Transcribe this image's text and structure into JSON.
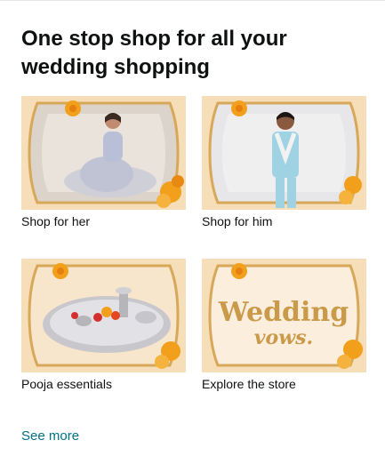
{
  "card": {
    "title": "One stop shop for all your wedding shopping",
    "see_more": "See more"
  },
  "tiles": [
    {
      "label": "Shop for her",
      "image": "woman-in-lehenga-photo"
    },
    {
      "label": "Shop for him",
      "image": "man-in-sherwani-photo"
    },
    {
      "label": "Pooja essentials",
      "image": "silver-pooja-thali-photo"
    },
    {
      "label": "Explore the store",
      "image": "wedding-vows-graphic",
      "image_text": [
        "Wedding",
        "vows."
      ]
    }
  ],
  "colors": {
    "background_cream": "#f6e3c3",
    "frame_gold": "#d8a85a",
    "marigold": "#f2a01c",
    "link": "#007185"
  }
}
